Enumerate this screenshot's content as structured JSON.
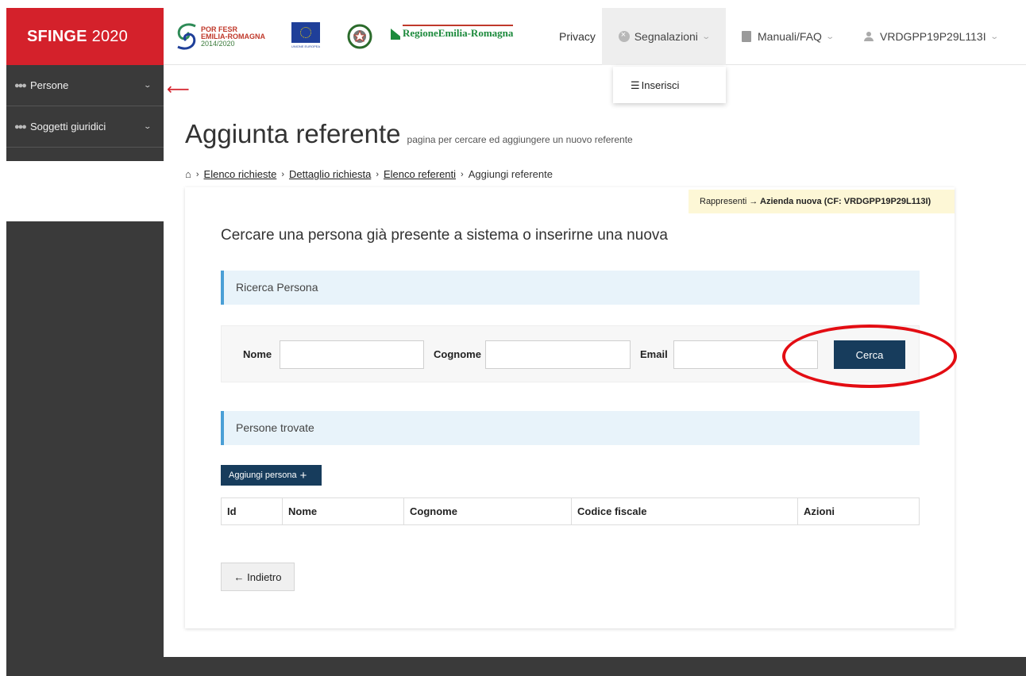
{
  "brand": {
    "bold": "SFINGE",
    "year": "2020"
  },
  "logos": {
    "por_line1": "POR FESR",
    "por_line2": "EMILIA-ROMAGNA",
    "por_line3": "2014/2020",
    "regione": "RegioneEmilia-Romagna"
  },
  "nav": {
    "privacy": "Privacy",
    "segnalazioni": "Segnalazioni",
    "manuali": "Manuali/FAQ",
    "user": "VRDGPP19P29L113I"
  },
  "dropdown": {
    "inserisci": "Inserisci"
  },
  "sidebar": {
    "items": [
      {
        "label": "Persone"
      },
      {
        "label": "Soggetti giuridici"
      }
    ]
  },
  "page": {
    "title": "Aggiunta referente",
    "subtitle": "pagina per cercare ed aggiungere un nuovo referente"
  },
  "breadcrumb": {
    "items": [
      "Elenco richieste",
      "Dettaglio richiesta",
      "Elenco referenti"
    ],
    "current": "Aggiungi referente"
  },
  "represent": {
    "prefix": "Rappresenti",
    "value": "Azienda nuova (CF: VRDGPP19P29L113I)"
  },
  "intro": "Cercare una persona già presente a sistema o inserirne una nuova",
  "search": {
    "heading": "Ricerca Persona",
    "nome_label": "Nome",
    "cognome_label": "Cognome",
    "email_label": "Email",
    "nome_value": "",
    "cognome_value": "",
    "email_value": "",
    "button": "Cerca"
  },
  "results": {
    "heading": "Persone trovate",
    "add_button": "Aggiungi persona",
    "columns": [
      "Id",
      "Nome",
      "Cognome",
      "Codice fiscale",
      "Azioni"
    ]
  },
  "back_button": "← Indietro",
  "colors": {
    "brand_red": "#d4212b",
    "primary_button": "#173c5c",
    "sidebar": "#3a3a3a",
    "annotation_red": "#e30d13"
  }
}
